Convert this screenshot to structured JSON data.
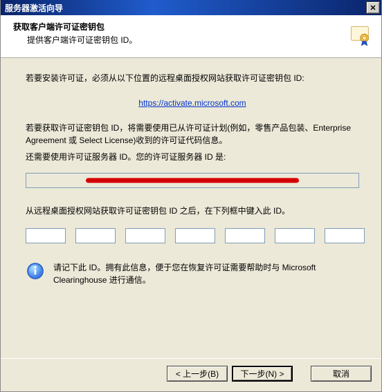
{
  "window": {
    "title": "服务器激活向导",
    "close_tooltip": "关闭"
  },
  "header": {
    "title": "获取客户端许可证密钥包",
    "subtitle": "提供客户端许可证密钥包 ID。"
  },
  "body": {
    "instr1": "若要安装许可证，必须从以下位置的远程桌面授权网站获取许可证密钥包 ID:",
    "link_label": "https://activate.microsoft.com",
    "instr2": "若要获取许可证密钥包 ID，将需要使用已从许可证计划(例如，零售产品包装、Enterprise Agreement 或 Select License)收到的许可证代码信息。",
    "instr3": "还需要使用许可证服务器 ID。您的许可证服务器 ID 是:",
    "server_id_value": "",
    "instr4": "从远程桌面授权网站获取许可证密钥包 ID 之后，在下列框中键入此 ID。",
    "info_text": "请记下此 ID。拥有此信息，便于您在恢复许可证需要帮助时与 Microsoft Clearinghouse 进行通信。"
  },
  "key_inputs": [
    "",
    "",
    "",
    "",
    "",
    "",
    ""
  ],
  "footer": {
    "back": "< 上一步(B)",
    "next": "下一步(N) >",
    "cancel": "取消"
  }
}
